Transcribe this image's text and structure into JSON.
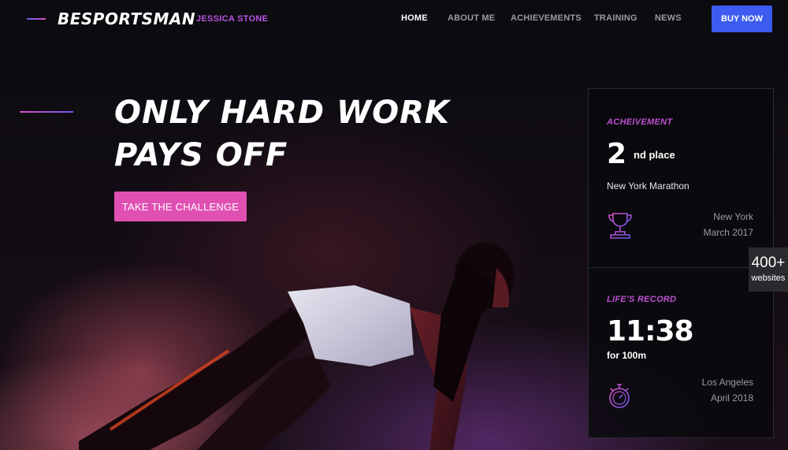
{
  "header": {
    "logo": "BESPORTSMAN",
    "tagline": "JESSICA STONE",
    "nav": [
      {
        "label": "HOME",
        "active": true
      },
      {
        "label": "ABOUT ME",
        "active": false
      },
      {
        "label": "ACHIEVEMENTS",
        "active": false
      },
      {
        "label": "TRAINING",
        "active": false
      },
      {
        "label": "NEWS",
        "active": false
      }
    ],
    "buy_label": "BUY NOW"
  },
  "hero": {
    "title_line1": "ONLY HARD WORK",
    "title_line2": "PAYS OFF",
    "cta_label": "TAKE THE CHALLENGE"
  },
  "cards": [
    {
      "label": "ACHEIVEMENT",
      "value": "2",
      "suffix": "nd place",
      "event": "New York Marathon",
      "location": "New York",
      "date": "March 2017",
      "icon": "trophy-icon"
    },
    {
      "label": "LIFE'S RECORD",
      "value": "11:38",
      "suffix": "for 100m",
      "event": "",
      "location": "Los Angeles",
      "date": "April 2018",
      "icon": "stopwatch-icon"
    }
  ],
  "badge": {
    "count": "400+",
    "text": "websites"
  },
  "colors": {
    "accent_pink": "#e050b3",
    "accent_purple": "#b655e0",
    "accent_blue": "#3d5bf0",
    "panel_border": "#2a2a34"
  }
}
